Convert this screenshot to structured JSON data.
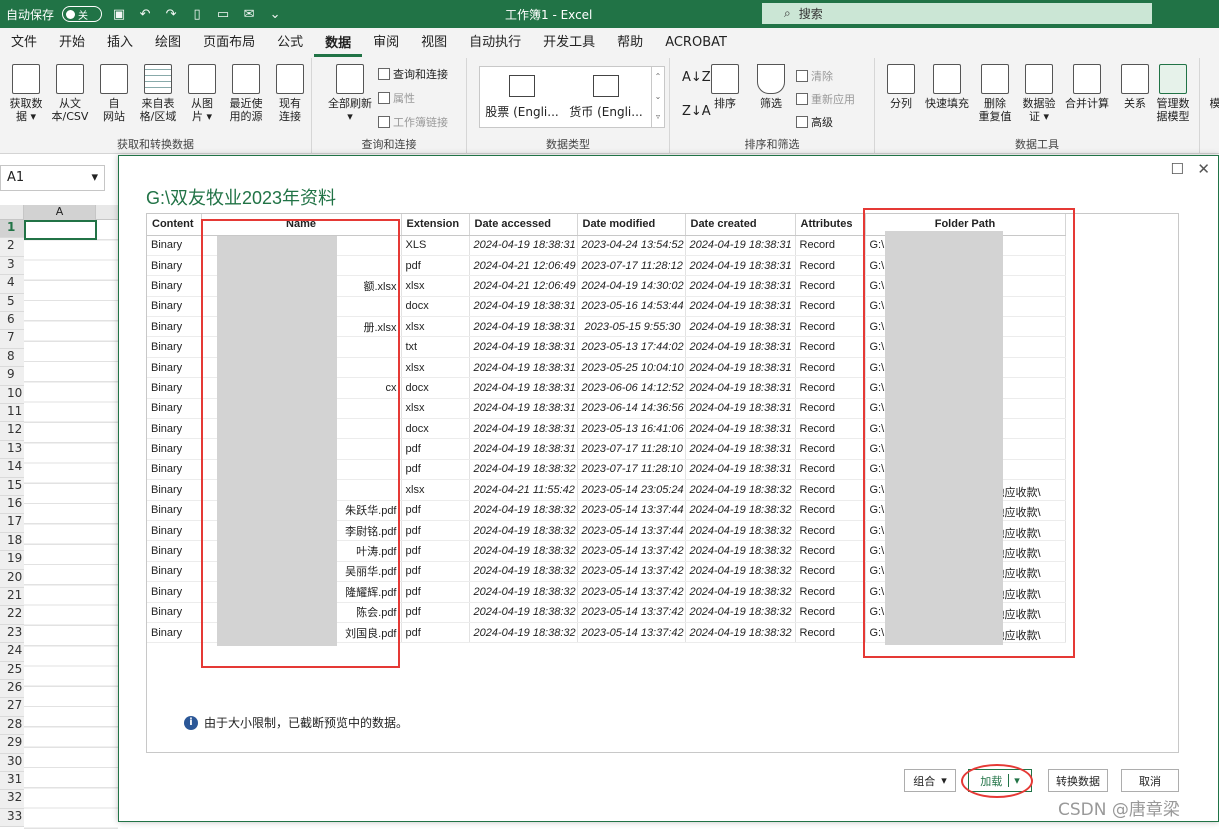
{
  "titlebar": {
    "autosave_label": "自动保存",
    "autosave_state": "关",
    "window_title": "工作簿1 - Excel",
    "search_placeholder": "搜索"
  },
  "menu": [
    "文件",
    "开始",
    "插入",
    "绘图",
    "页面布局",
    "公式",
    "数据",
    "审阅",
    "视图",
    "自动执行",
    "开发工具",
    "帮助",
    "ACROBAT"
  ],
  "active_menu": "数据",
  "ribbon": {
    "get_transform": {
      "label": "获取和转换数据",
      "buttons": [
        "获取数\n据 ▾",
        "从文\n本/CSV",
        "自\n网站",
        "来自表\n格/区域",
        "从图\n片 ▾",
        "最近使\n用的源",
        "现有\n连接"
      ]
    },
    "queries": {
      "label": "查询和连接",
      "refresh_all": "全部刷新",
      "refresh_arrow": "▾",
      "items": [
        "查询和连接",
        "属性",
        "工作簿链接"
      ]
    },
    "data_types": {
      "label": "数据类型",
      "stocks": "股票 (Engli...",
      "currencies": "货币 (Engli..."
    },
    "sort_filter": {
      "label": "排序和筛选",
      "sort": "排序",
      "filter": "筛选",
      "clear": "清除",
      "reapply": "重新应用",
      "advanced": "高级"
    },
    "data_tools": {
      "label": "数据工具",
      "buttons": [
        "分列",
        "快速填充",
        "删除\n重复值",
        "数据验\n证 ▾",
        "合并计算",
        "关系",
        "管理数\n据模型"
      ],
      "cut_off": "模"
    }
  },
  "namebox": {
    "value": "A1",
    "arrow": "▾"
  },
  "sheet": {
    "column": "A",
    "rows": [
      "1",
      "2",
      "3",
      "4",
      "5",
      "6",
      "7",
      "8",
      "9",
      "10",
      "11",
      "12",
      "13",
      "14",
      "15",
      "16",
      "17",
      "18",
      "19",
      "20",
      "21",
      "22",
      "23",
      "24",
      "25",
      "26",
      "27",
      "28",
      "29",
      "30",
      "31",
      "32",
      "33"
    ]
  },
  "dialog": {
    "title": "G:\\双友牧业2023年资料",
    "columns": [
      "Content",
      "Name",
      "Extension",
      "Date accessed",
      "Date modified",
      "Date created",
      "Attributes",
      "Folder Path"
    ],
    "rows": [
      [
        "Binary",
        "",
        "XLS",
        "2024-04-19 18:38:31",
        "2023-04-24 13:54:52",
        "2024-04-19 18:38:31",
        "Record",
        "G:\\"
      ],
      [
        "Binary",
        "",
        "pdf",
        "2024-04-21 12:06:49",
        "2023-07-17 11:28:12",
        "2024-04-19 18:38:31",
        "Record",
        "G:\\"
      ],
      [
        "Binary",
        "额.xlsx",
        "xlsx",
        "2024-04-21 12:06:49",
        "2024-04-19 14:30:02",
        "2024-04-19 18:38:31",
        "Record",
        "G:\\"
      ],
      [
        "Binary",
        "",
        "docx",
        "2024-04-19 18:38:31",
        "2023-05-16 14:53:44",
        "2024-04-19 18:38:31",
        "Record",
        "G:\\"
      ],
      [
        "Binary",
        "册.xlsx",
        "xlsx",
        "2024-04-19 18:38:31",
        "2023-05-15 9:55:30",
        "2024-04-19 18:38:31",
        "Record",
        "G:\\"
      ],
      [
        "Binary",
        "",
        "txt",
        "2024-04-19 18:38:31",
        "2023-05-13 17:44:02",
        "2024-04-19 18:38:31",
        "Record",
        "G:\\"
      ],
      [
        "Binary",
        "",
        "xlsx",
        "2024-04-19 18:38:31",
        "2023-05-25 10:04:10",
        "2024-04-19 18:38:31",
        "Record",
        "G:\\"
      ],
      [
        "Binary",
        "cx",
        "docx",
        "2024-04-19 18:38:31",
        "2023-06-06 14:12:52",
        "2024-04-19 18:38:31",
        "Record",
        "G:\\"
      ],
      [
        "Binary",
        "",
        "xlsx",
        "2024-04-19 18:38:31",
        "2023-06-14 14:36:56",
        "2024-04-19 18:38:31",
        "Record",
        "G:\\"
      ],
      [
        "Binary",
        "",
        "docx",
        "2024-04-19 18:38:31",
        "2023-05-13 16:41:06",
        "2024-04-19 18:38:31",
        "Record",
        "G:\\"
      ],
      [
        "Binary",
        "",
        "pdf",
        "2024-04-19 18:38:31",
        "2023-07-17 11:28:10",
        "2024-04-19 18:38:31",
        "Record",
        "G:\\"
      ],
      [
        "Binary",
        "",
        "pdf",
        "2024-04-19 18:38:32",
        "2023-07-17 11:28:10",
        "2024-04-19 18:38:31",
        "Record",
        "G:\\"
      ],
      [
        "Binary",
        "",
        "xlsx",
        "2024-04-21 11:55:42",
        "2023-05-14 23:05:24",
        "2024-04-19 18:38:32",
        "Record",
        "G:\\"
      ],
      [
        "Binary",
        "朱跃华.pdf",
        "pdf",
        "2024-04-19 18:38:32",
        "2023-05-14 13:37:44",
        "2024-04-19 18:38:32",
        "Record",
        "G:\\"
      ],
      [
        "Binary",
        "李尉铭.pdf",
        "pdf",
        "2024-04-19 18:38:32",
        "2023-05-14 13:37:44",
        "2024-04-19 18:38:32",
        "Record",
        "G:\\"
      ],
      [
        "Binary",
        "叶涛.pdf",
        "pdf",
        "2024-04-19 18:38:32",
        "2023-05-14 13:37:42",
        "2024-04-19 18:38:32",
        "Record",
        "G:\\"
      ],
      [
        "Binary",
        "吴丽华.pdf",
        "pdf",
        "2024-04-19 18:38:32",
        "2023-05-14 13:37:42",
        "2024-04-19 18:38:32",
        "Record",
        "G:\\"
      ],
      [
        "Binary",
        "隆耀辉.pdf",
        "pdf",
        "2024-04-19 18:38:32",
        "2023-05-14 13:37:42",
        "2024-04-19 18:38:32",
        "Record",
        "G:\\"
      ],
      [
        "Binary",
        "陈会.pdf",
        "pdf",
        "2024-04-19 18:38:32",
        "2023-05-14 13:37:42",
        "2024-04-19 18:38:32",
        "Record",
        "G:\\"
      ],
      [
        "Binary",
        "刘国良.pdf",
        "pdf",
        "2024-04-19 18:38:32",
        "2023-05-14 13:37:42",
        "2024-04-19 18:38:32",
        "Record",
        "G:\\"
      ]
    ],
    "folder_tail": "他应收款\\",
    "notice": "由于大小限制，已截断预览中的数据。",
    "buttons": {
      "combine": "组合",
      "combine_arrow": "▾",
      "load": "加载",
      "load_arrow": "▾",
      "transform": "转换数据",
      "cancel": "取消"
    },
    "window_controls": {
      "maximize": "☐",
      "close": "✕"
    }
  },
  "watermark": "CSDN @唐章梁",
  "colors": {
    "excel_green": "#217346",
    "annotation_red": "#e53935"
  }
}
